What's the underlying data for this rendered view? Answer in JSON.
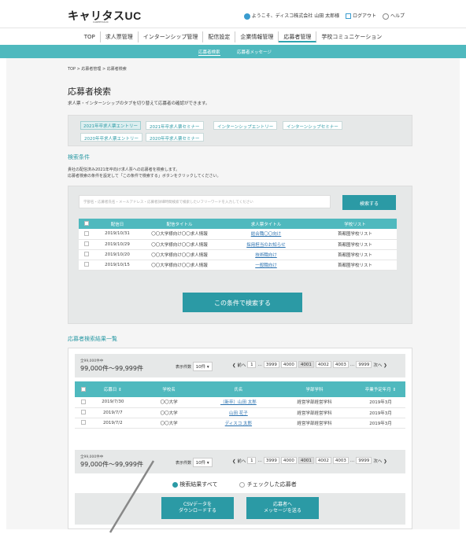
{
  "header": {
    "logo": "キャリタスUC",
    "logo_sub": "CAREETASUC",
    "welcome": "ようこそ、ディスコ株式会社 山田 太郎様",
    "logout": "ログアウト",
    "help": "ヘルプ"
  },
  "nav": [
    "TOP",
    "求人票管理",
    "インターンシップ管理",
    "配信設定",
    "企業情報管理",
    "応募者管理",
    "学校コミュニケーション"
  ],
  "subnav": {
    "search": "応募者検索",
    "message": "応募者メッセージ"
  },
  "breadcrumb": "TOP > 応募者管理 > 応募者検索",
  "page_title": "応募者検索",
  "page_desc": "求人票・インターンシップのタブを切り替えて応募者の確認ができます。",
  "tabs": [
    "2021年卒求人票エントリー",
    "2021年卒求人票セミナー",
    "インターンシップエントリー",
    "インターンシップセミナー",
    "2020年卒求人票エントリー",
    "2020年卒求人票セミナー"
  ],
  "search_cond": {
    "title": "検索条件",
    "desc1": "貴社の配信済み2021年卒向け求人票への応募者を検索します。",
    "desc2": "応募者検索の条件を設定して「この条件で検索する」ボタンをクリックしてください。",
    "placeholder": "学部名・応募者氏名・メールアドレス・応募者詳細時間検索で検索したいフリーワードを入力してください",
    "search_btn": "検索する",
    "headers": [
      "",
      "配信日",
      "配信タイトル",
      "求人票タイトル",
      "学校リスト"
    ],
    "rows": [
      [
        "2019/10/31",
        "〇〇大学様向け〇〇求人情報",
        "総合職〇〇向け",
        "首都圏学校リスト"
      ],
      [
        "2019/10/29",
        "〇〇大学様向け〇〇求人情報",
        "採用担当のお知らせ",
        "首都圏学校リスト"
      ],
      [
        "2019/10/20",
        "〇〇大学様向け〇〇求人情報",
        "技術職向け",
        "首都圏学校リスト"
      ],
      [
        "2019/10/15",
        "〇〇大学様向け〇〇求人情報",
        "一般職向け",
        "首都圏学校リスト"
      ]
    ],
    "submit": "この条件で検索する"
  },
  "results": {
    "title": "応募者検索結果一覧",
    "count_label": "全99,000件中",
    "count_range": "99,000件～99,999件",
    "per_page_label": "表示件数",
    "per_page": "10件",
    "prev": "前へ",
    "next": "次へ",
    "pages": [
      "1",
      "3999",
      "4000",
      "4001",
      "4002",
      "4003",
      "9999"
    ],
    "headers": [
      "",
      "応募日",
      "学校名",
      "氏名",
      "学部学科",
      "卒業予定年月"
    ],
    "rows": [
      [
        "2019/7/30",
        "〇〇大学",
        "（新卒）山田 太郎",
        "経営学部経営学科",
        "2019年3月"
      ],
      [
        "2019/7/7",
        "〇〇大学",
        "山田 花子",
        "経営学部経営学科",
        "2019年3月"
      ],
      [
        "2019/7/2",
        "〇〇大学",
        "ディスコ 太郎",
        "経営学部経営学科",
        "2019年3月"
      ]
    ],
    "radio_all": "検索結果すべて",
    "radio_checked": "チェックした応募者",
    "csv_btn_1": "CSVデータを",
    "csv_btn_2": "ダウンロードする",
    "msg_btn_1": "応募者へ",
    "msg_btn_2": "メッセージを送る"
  }
}
